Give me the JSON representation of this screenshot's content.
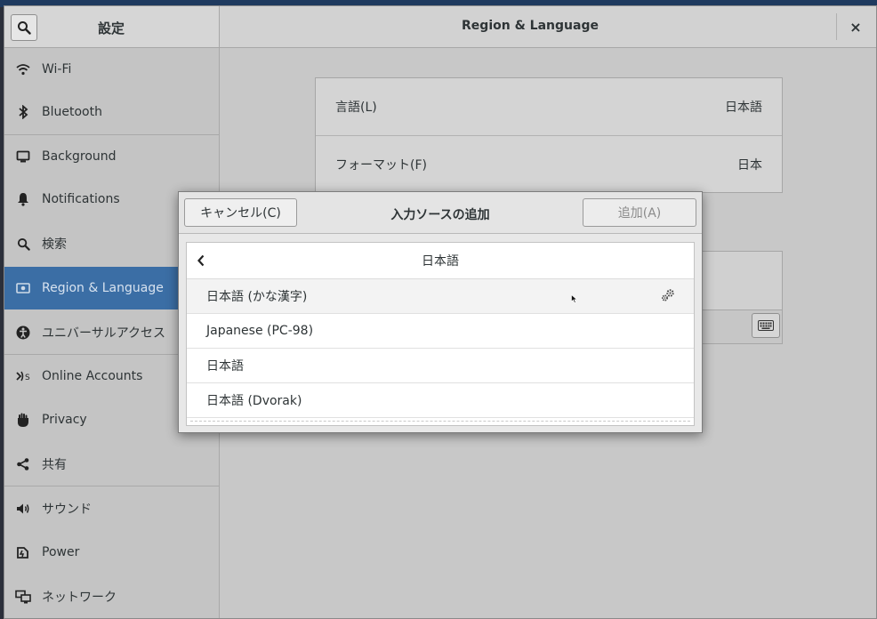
{
  "sidebar": {
    "title": "設定",
    "items": [
      {
        "label": "Wi-Fi",
        "icon": "wifi-icon"
      },
      {
        "label": "Bluetooth",
        "icon": "bluetooth-icon"
      },
      {
        "label": "Background",
        "icon": "background-icon"
      },
      {
        "label": "Notifications",
        "icon": "bell-icon"
      },
      {
        "label": "検索",
        "icon": "search-icon"
      },
      {
        "label": "Region & Language",
        "icon": "flag-icon",
        "active": true
      },
      {
        "label": "ユニバーサルアクセス",
        "icon": "accessibility-icon"
      },
      {
        "label": "Online Accounts",
        "icon": "online-accounts-icon"
      },
      {
        "label": "Privacy",
        "icon": "hand-icon"
      },
      {
        "label": "共有",
        "icon": "share-icon"
      },
      {
        "label": "サウンド",
        "icon": "speaker-icon"
      },
      {
        "label": "Power",
        "icon": "power-icon"
      },
      {
        "label": "ネットワーク",
        "icon": "network-icon"
      }
    ]
  },
  "header": {
    "title": "Region & Language",
    "close_label": "×"
  },
  "main": {
    "language_label": "言語(L)",
    "language_value": "日本語",
    "formats_label": "フォーマット(F)",
    "formats_value": "日本"
  },
  "dialog": {
    "title": "入力ソースの追加",
    "cancel_label": "キャンセル(C)",
    "add_label": "追加(A)",
    "list_header": "日本語",
    "items": [
      {
        "label": "日本語 (かな漢字)",
        "has_settings": true
      },
      {
        "label": "Japanese (PC-98)"
      },
      {
        "label": "日本語"
      },
      {
        "label": "日本語 (Dvorak)"
      }
    ]
  },
  "colors": {
    "accent": "#3b6ea5",
    "sidebar_bg": "#c4c4c4",
    "dialog_bg": "#e8e8e8"
  }
}
